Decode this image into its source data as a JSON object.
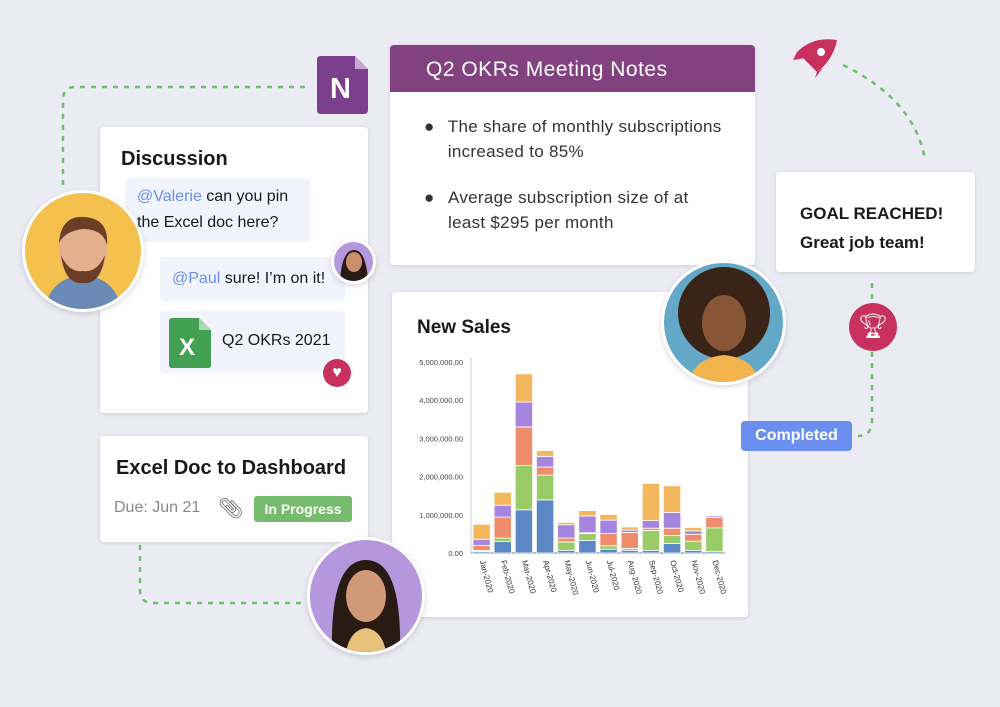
{
  "notes": {
    "title": "Q2 OKRs Meeting Notes",
    "bullets": [
      "The share of monthly subscriptions increased to 85%",
      "Average subscription size of at least $295 per month"
    ],
    "header_color": "#82417f"
  },
  "onenote": {
    "letter": "N",
    "color": "#7b3f8e"
  },
  "discussion": {
    "title": "Discussion",
    "msg1": {
      "mention": "@Valerie",
      "text": " can you pin the Excel doc here?"
    },
    "msg2": {
      "mention": "@Paul",
      "text": " sure! I’m on it!"
    },
    "file": {
      "name": "Q2 OKRs 2021",
      "icon": "excel-icon"
    },
    "reaction": "heart-icon"
  },
  "task": {
    "title": "Excel Doc to Dashboard",
    "due": "Due: Jun 21",
    "status": "In Progress",
    "status_color": "#77bb6f"
  },
  "goal": {
    "line1": "GOAL REACHED!",
    "line2": "Great job team!"
  },
  "completed": {
    "label": "Completed",
    "color": "#6b8ff0"
  },
  "icons": {
    "rocket": "rocket-icon",
    "trophy": "trophy-icon",
    "accent": "#c8315e"
  },
  "sales": {
    "title": "New Sales"
  },
  "chart_data": {
    "type": "bar",
    "stacked": true,
    "categories": [
      "Jan-2020",
      "Feb-2020",
      "Mar-2020",
      "Apr-2020",
      "May-2020",
      "Jun-2020",
      "Jul-2020",
      "Aug-2020",
      "Sep-2020",
      "Oct-2020",
      "Nov-2020",
      "Dec-2020"
    ],
    "yticks": [
      "0.00",
      "1,000,000.00",
      "2,000,000.00",
      "3,000,000.00",
      "4,000,000.00",
      "5,000,000.00"
    ],
    "ylim": [
      0,
      5000000
    ],
    "colors": [
      "#5b87c5",
      "#99cc66",
      "#ef8c6c",
      "#a585e0",
      "#f3b75e"
    ],
    "series": [
      {
        "values": [
          40000,
          300000,
          1130000,
          1390000,
          70000,
          330000,
          100000,
          70000,
          70000,
          250000,
          70000,
          40000
        ]
      },
      {
        "values": [
          30000,
          90000,
          1160000,
          650000,
          220000,
          180000,
          90000,
          50000,
          520000,
          210000,
          240000,
          620000
        ]
      },
      {
        "values": [
          130000,
          550000,
          1010000,
          210000,
          100000,
          20000,
          320000,
          420000,
          60000,
          190000,
          180000,
          270000
        ]
      },
      {
        "values": [
          160000,
          310000,
          650000,
          280000,
          350000,
          440000,
          350000,
          60000,
          200000,
          410000,
          90000,
          40000
        ]
      },
      {
        "values": [
          390000,
          340000,
          740000,
          150000,
          60000,
          140000,
          150000,
          80000,
          970000,
          700000,
          90000,
          0
        ]
      }
    ]
  }
}
